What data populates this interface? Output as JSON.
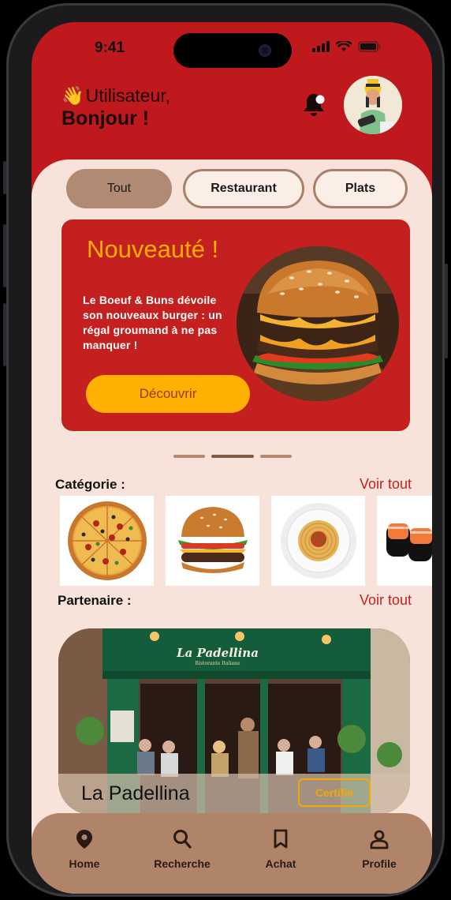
{
  "status_bar": {
    "time": "9:41"
  },
  "header": {
    "wave_emoji": "👋",
    "greeting_line1": "Utilisateur,",
    "greeting_line2": "Bonjour !",
    "notification_icon": "bell-icon",
    "avatar_icon": "user-avatar"
  },
  "filters": [
    {
      "label": "Tout",
      "active": true
    },
    {
      "label": "Restaurant",
      "active": false
    },
    {
      "label": "Plats",
      "active": false
    }
  ],
  "promo": {
    "title": "Nouveauté !",
    "description": "Le Boeuf & Buns dévoile son nouveaux burger : un régal groumand à ne pas manquer !",
    "button_label": "Découvrir",
    "carousel_total": 3,
    "carousel_active": 2
  },
  "categories": {
    "title": "Catégorie :",
    "see_all": "Voir tout",
    "items": [
      "pizza",
      "burger",
      "spaghetti",
      "sushi"
    ]
  },
  "partners": {
    "title": "Partenaire :",
    "see_all": "Voir tout",
    "featured": {
      "name": "La Padellina",
      "sign_text": "La Padellina",
      "sign_subtext": "Ristorante Italiano",
      "badge": "Certifié"
    }
  },
  "bottom_nav": [
    {
      "label": "Home",
      "icon": "location-pin-icon"
    },
    {
      "label": "Recherche",
      "icon": "search-icon"
    },
    {
      "label": "Achat",
      "icon": "bookmark-icon"
    },
    {
      "label": "Profile",
      "icon": "user-icon"
    }
  ],
  "colors": {
    "brand_red": "#c0191d",
    "accent_yellow": "#ffb000",
    "content_bg": "#f8e3da",
    "brown": "#b08468"
  }
}
